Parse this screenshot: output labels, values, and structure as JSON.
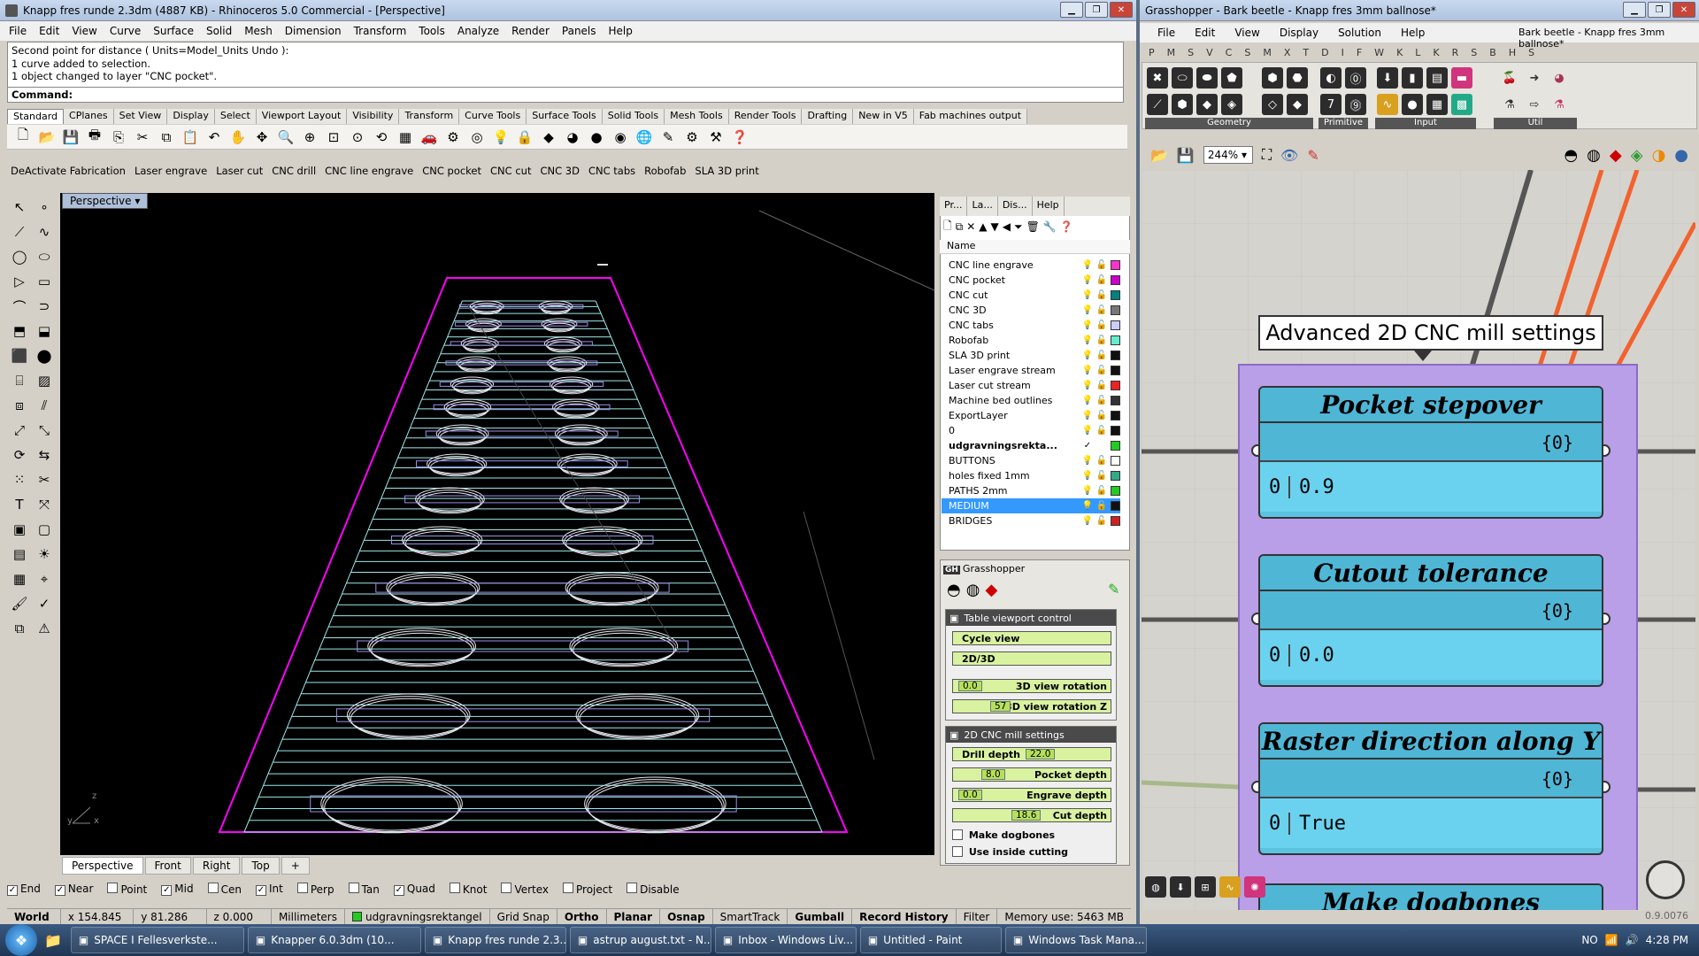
{
  "rhino": {
    "title": "Knapp fres runde 2.3dm (4887 KB) - Rhinoceros 5.0 Commercial - [Perspective]",
    "menu": [
      "File",
      "Edit",
      "View",
      "Curve",
      "Surface",
      "Solid",
      "Mesh",
      "Dimension",
      "Transform",
      "Tools",
      "Analyze",
      "Render",
      "Panels",
      "Help"
    ],
    "command_history": [
      "Second point for distance ( Units=Model_Units  Undo ):",
      "1 curve added to selection.",
      "1 object changed to layer \"CNC pocket\"."
    ],
    "command_prompt": "Command:",
    "toolbar_tabs": [
      "Standard",
      "CPlanes",
      "Set View",
      "Display",
      "Select",
      "Viewport Layout",
      "Visibility",
      "Transform",
      "Curve Tools",
      "Surface Tools",
      "Solid Tools",
      "Mesh Tools",
      "Render Tools",
      "Drafting",
      "New in V5",
      "Fab machines output"
    ],
    "macro_buttons": [
      "DeActivate Fabrication",
      "Laser engrave",
      "Laser cut",
      "CNC drill",
      "CNC line engrave",
      "CNC pocket",
      "CNC cut",
      "CNC 3D",
      "CNC tabs",
      "Robofab",
      "SLA 3D print"
    ],
    "viewport_label": "Perspective",
    "viewport_tabs": [
      "Perspective",
      "Front",
      "Right",
      "Top"
    ],
    "osnaps": [
      {
        "label": "End",
        "checked": true
      },
      {
        "label": "Near",
        "checked": true
      },
      {
        "label": "Point",
        "checked": false
      },
      {
        "label": "Mid",
        "checked": true
      },
      {
        "label": "Cen",
        "checked": false
      },
      {
        "label": "Int",
        "checked": true
      },
      {
        "label": "Perp",
        "checked": false
      },
      {
        "label": "Tan",
        "checked": false
      },
      {
        "label": "Quad",
        "checked": true
      },
      {
        "label": "Knot",
        "checked": false
      },
      {
        "label": "Vertex",
        "checked": false
      },
      {
        "label": "Project",
        "checked": false
      },
      {
        "label": "Disable",
        "checked": false
      }
    ],
    "status": {
      "cplane": "World",
      "x": "x 154.845",
      "y": "y 81.286",
      "z": "z 0.000",
      "units": "Millimeters",
      "layer": "udgravningsrektangel",
      "grid_snap": "Grid Snap",
      "ortho": "Ortho",
      "planar": "Planar",
      "osnap": "Osnap",
      "smarttrack": "SmartTrack",
      "gumball": "Gumball",
      "record": "Record History",
      "filter": "Filter",
      "memory": "Memory use: 5463 MB"
    },
    "axis_z": "z",
    "axis_y": "y",
    "axis_x": "x"
  },
  "layers_panel": {
    "tabs": [
      "Pr...",
      "La...",
      "Dis...",
      "Help"
    ],
    "header": "Name",
    "rows": [
      {
        "name": "CNC line engrave",
        "color": "#ff33cc"
      },
      {
        "name": "CNC pocket",
        "color": "#cc00cc"
      },
      {
        "name": "CNC cut",
        "color": "#008080"
      },
      {
        "name": "CNC 3D",
        "color": "#777777"
      },
      {
        "name": "CNC tabs",
        "color": "#ccccff"
      },
      {
        "name": "Robofab",
        "color": "#66eecc"
      },
      {
        "name": "SLA 3D print",
        "color": "#111111"
      },
      {
        "name": "Laser engrave stream",
        "color": "#111111"
      },
      {
        "name": "Laser cut stream",
        "color": "#ee2222"
      },
      {
        "name": "Machine bed outlines",
        "color": "#333333"
      },
      {
        "name": "ExportLayer",
        "color": "#111111"
      },
      {
        "name": "0",
        "color": "#111111"
      },
      {
        "name": "udgravningsrekta...",
        "color": "#22cc22"
      },
      {
        "name": "BUTTONS",
        "color": "#ffffff"
      },
      {
        "name": "holes fixed 1mm",
        "color": "#33aa88"
      },
      {
        "name": "PATHS 2mm",
        "color": "#22cc22"
      },
      {
        "name": "MEDIUM",
        "color": "#111111"
      },
      {
        "name": "BRIDGES",
        "color": "#cc2222"
      }
    ]
  },
  "gh_panel": {
    "title": "Grasshopper",
    "group1": "Table viewport control",
    "cycle_view": "Cycle view",
    "view_2d3d": "2D/3D",
    "rot3d_val": "0.0",
    "rot3d_label": "3D view rotation",
    "rotz_val": "57",
    "rotz_label": "3D view rotation Z",
    "group2": "2D CNC mill settings",
    "drill_label": "Drill depth",
    "drill_val": "22.0",
    "pocket_val": "8.0",
    "pocket_label": "Pocket depth",
    "engrave_val": "0.0",
    "engrave_label": "Engrave depth",
    "cut_val": "18.6",
    "cut_label": "Cut depth",
    "dogbones": "Make dogbones",
    "inside": "Use inside cutting"
  },
  "grasshopper": {
    "title": "Grasshopper - Bark beetle - Knapp fres 3mm ballnose*",
    "doc_title": "Bark beetle - Knapp fres 3mm ballnose*",
    "menu": [
      "File",
      "Edit",
      "View",
      "Display",
      "Solution",
      "Help"
    ],
    "tabs": [
      "P",
      "M",
      "S",
      "V",
      "C",
      "S",
      "M",
      "X",
      "T",
      "D",
      "I",
      "F",
      "W",
      "K",
      "L",
      "K",
      "R",
      "S",
      "B",
      "H",
      "S"
    ],
    "ribbon_groups": [
      "Geometry",
      "Primitive",
      "Input",
      "Util"
    ],
    "zoom": "244%",
    "group_title": "Advanced 2D CNC mill settings",
    "params": [
      {
        "title": "Pocket stepover",
        "path": "{0}",
        "index": "0",
        "value": "0.9"
      },
      {
        "title": "Cutout tolerance",
        "path": "{0}",
        "index": "0",
        "value": "0.0"
      },
      {
        "title": "Raster direction along Y",
        "path": "{0}",
        "index": "0",
        "value": "True"
      },
      {
        "title": "Make dogbones"
      }
    ],
    "version": "0.9.0076"
  },
  "taskbar": {
    "items": [
      "SPACE I Fellesverkste...",
      "Knapper 6.0.3dm (10...",
      "Knapp fres runde 2.3...",
      "astrup august.txt - N...",
      "Inbox - Windows Liv...",
      "Untitled - Paint",
      "Windows Task Mana..."
    ],
    "lang": "NO",
    "clock": "4:28 PM"
  }
}
